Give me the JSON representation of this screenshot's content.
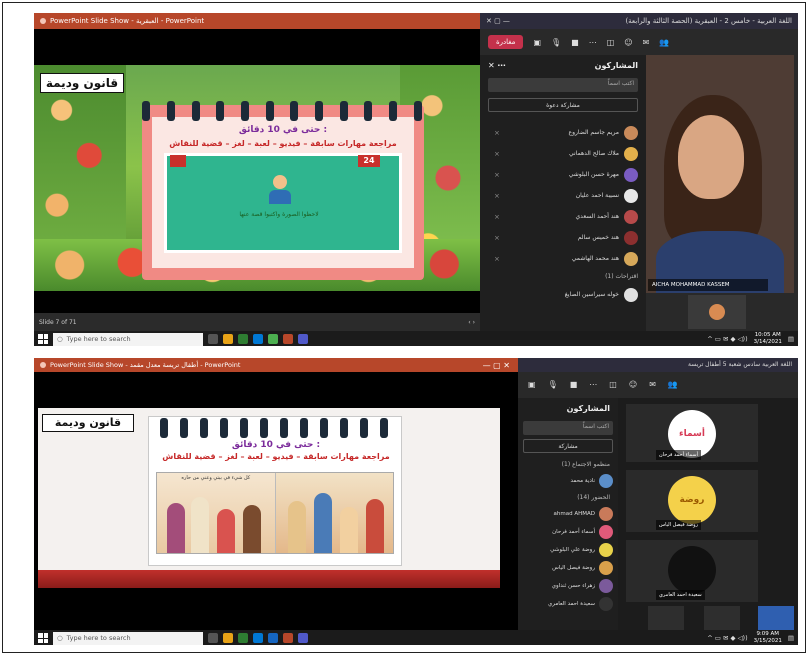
{
  "top": {
    "ppt_title": "PowerPoint Slide Show - العبقرية - PowerPoint",
    "label": "قانون وديمة",
    "slide_title": "حتى في 10 دقائق :",
    "slide_subtitle": "مراجعة مهارات سابقة – فيديو – لعبة – لغز – قضية للنقاش",
    "slide_number": "24",
    "slide_caption": "لاحظوا الصورة واكتبوا قصة عنها",
    "slide_counter": "Slide 7 of 71",
    "teams_title": "اللغة العربية - خامس 2 - العبقرية (الحصة الثالثة والرابعة)",
    "leave_label": "مغادرة",
    "participants_title": "المشاركون",
    "search_placeholder": "اكتب اسماً",
    "invite_label": "مشاركة دعوة",
    "participants": [
      "مريم جاسم الضاروع",
      "ملاك صالح الدهماني",
      "مهرة حسن البلوشي",
      "نسيبة احمد عليان",
      "هند أحمد السعدي",
      "هند خميس سالم",
      "هند محمد الهاشمي"
    ],
    "suggested_label": "اقتراحات (1)",
    "suggested_person": "خوله سيراسين الصايغ",
    "video_name": "AICHA MOHAMMAD KASSEM",
    "taskbar_search": "Type here to search",
    "time": "10:05 AM",
    "date": "3/14/2021"
  },
  "bottom": {
    "ppt_title": "PowerPoint Slide Show - أطفال تريسة معدل مقمد - PowerPoint",
    "label": "قانون وديمة",
    "slide_title": "حتى في 10 دقائق :",
    "slide_subtitle": "مراجعة مهارات سابقة – فيديو – لعبة – لغز – قضية للنقاش",
    "book_caption": "كل شيء في بيتي وعني من حاره",
    "teams_title": "اللغة العربية سادس شعبة 5 أطفال تريسة",
    "participants_title": "المشاركون",
    "search_placeholder": "اكتب اسماً",
    "invite_label": "مشاركة",
    "organizer_label": "منظمو الاجتماع (1)",
    "organizer": "نادية محمد",
    "attendees_label": "الحضور (14)",
    "participants": [
      "ahmad AHMAD",
      "أسماء أحمد فرحان",
      "روضة علي البلوشي",
      "روضة فيصل الياس",
      "زهراء حسن ثنداوي",
      "سعيدة احمد العامري"
    ],
    "tiles": [
      {
        "text": "أسماء",
        "name": "أسماء أحمد فرحان"
      },
      {
        "text": "روضة",
        "name": "روضة فيصل الياس"
      },
      {
        "text": "",
        "name": "سعيدة احمد العامري"
      }
    ],
    "taskbar_search": "Type here to search",
    "time": "9:09 AM",
    "date": "3/15/2021"
  }
}
